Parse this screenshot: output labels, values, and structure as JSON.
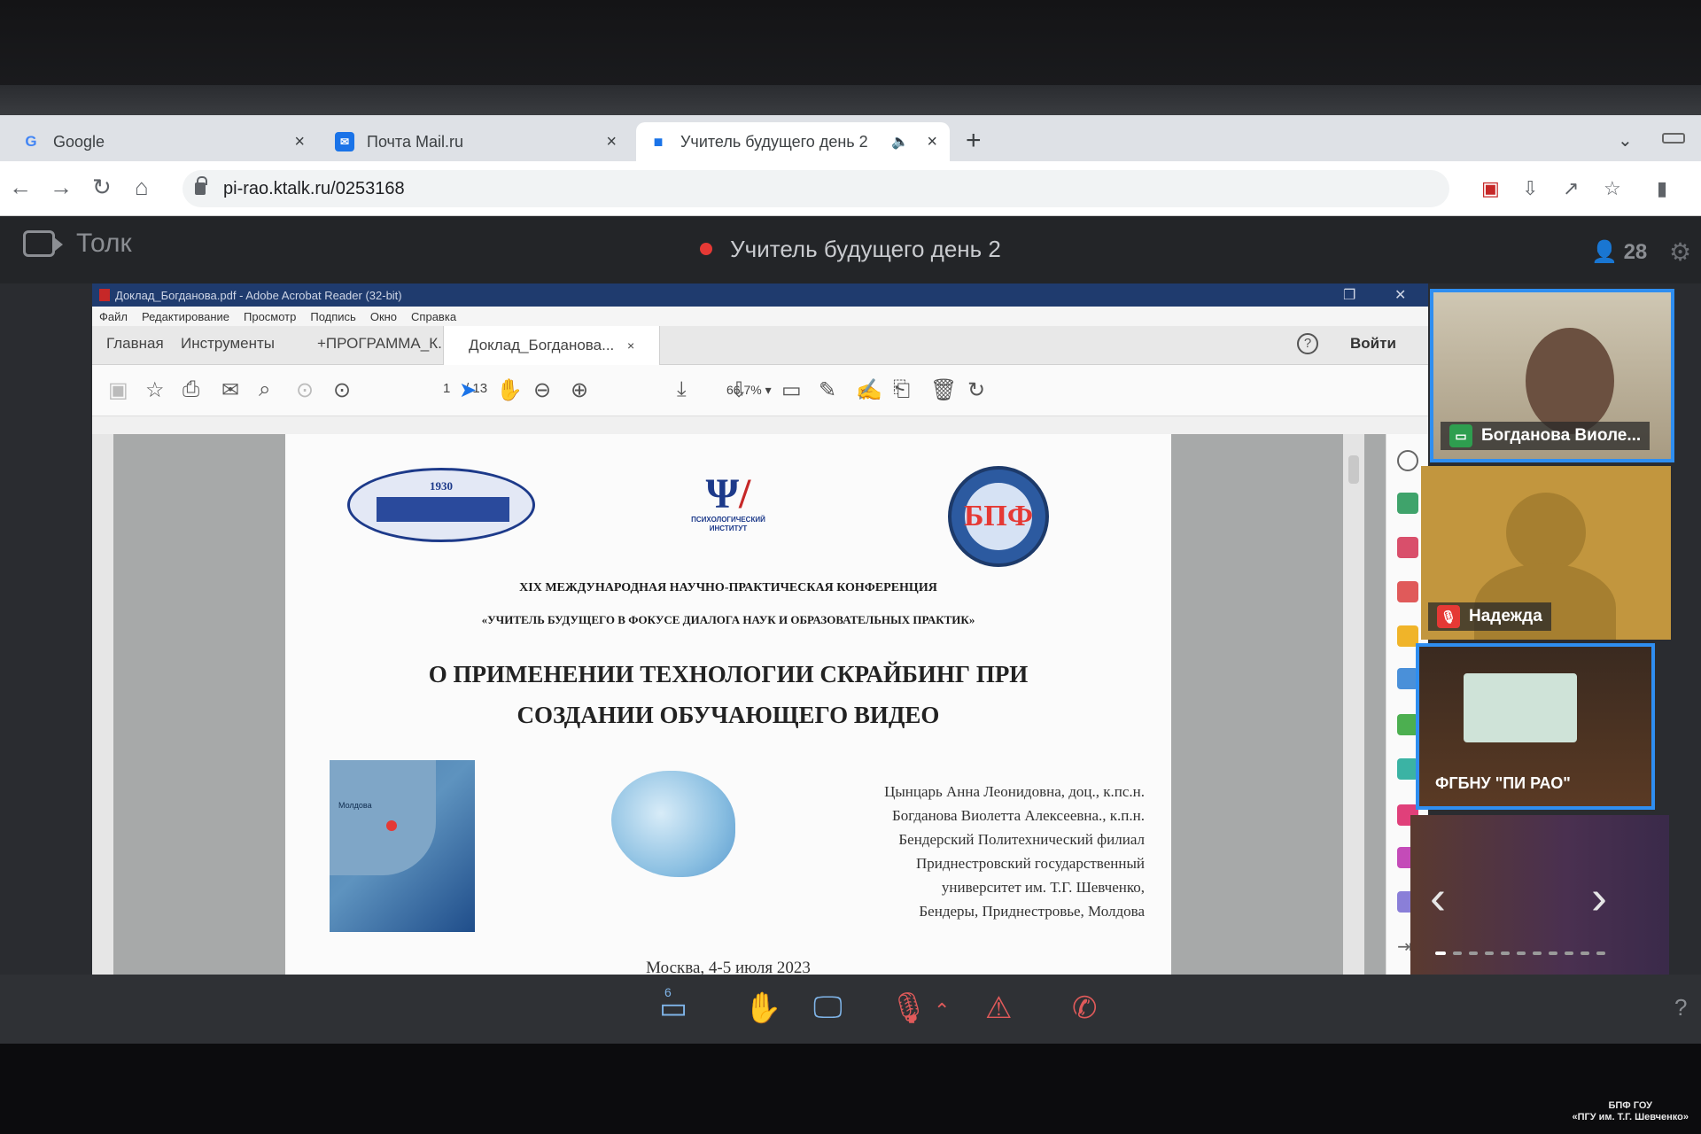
{
  "browser": {
    "tabs": [
      {
        "label": "Google"
      },
      {
        "label": "Почта Mail.ru"
      },
      {
        "label": "Учитель будущего день 2"
      }
    ],
    "url": "pi-rao.ktalk.ru/0253168"
  },
  "tolk": {
    "logo_label": "Толк",
    "meeting_title": "Учитель будущего день 2",
    "participant_count": "28"
  },
  "acrobat": {
    "window_title": "Доклад_Богданова.pdf - Adobe Acrobat Reader (32-bit)",
    "menu": [
      "Файл",
      "Редактирование",
      "Просмотр",
      "Подпись",
      "Окно",
      "Справка"
    ],
    "tabs": {
      "home": "Главная",
      "tools": "Инструменты",
      "doc1": "+ПРОГРАММА_К...",
      "doc2": "Доклад_Богданова..."
    },
    "signin": "Войти",
    "page_current": "1",
    "page_total": "/ 13",
    "zoom": "66,7%"
  },
  "document": {
    "logo_year": "1930",
    "logo2_text": "ПСИХОЛОГИЧЕСКИЙ ИНСТИТУТ",
    "logo3_text": "БПФ",
    "conference_line1": "XIX МЕЖДУНАРОДНАЯ НАУЧНО-ПРАКТИЧЕСКАЯ КОНФЕРЕНЦИЯ",
    "conference_line2": "«УЧИТЕЛЬ БУДУЩЕГО В ФОКУСЕ ДИАЛОГА НАУК И ОБРАЗОВАТЕЛЬНЫХ ПРАКТИК»",
    "title_line1": "О ПРИМЕНЕНИИ ТЕХНОЛОГИИ СКРАЙБИНГ ПРИ",
    "title_line2": "СОЗДАНИИ ОБУЧАЮЩЕГО ВИДЕО",
    "map_label": "Молдова",
    "authors": [
      "Цынцарь Анна Леонидовна, доц., к.пс.н.",
      "Богданова Виолетта Алексеевна., к.п.н.",
      "Бендерский Политехнический филиал",
      "Приднестровский государственный",
      "университет им. Т.Г. Шевченко,",
      "Бендеры, Приднестровье, Молдова"
    ],
    "city_date": "Москва, 4-5 июля 2023"
  },
  "participants": [
    {
      "name": "Богданова Виоле..."
    },
    {
      "name": "Надежда"
    },
    {
      "name": "ФГБНУ \"ПИ РАО\""
    }
  ],
  "controls": {
    "hand_count": "6",
    "help": "?"
  },
  "watermark": {
    "line1": "БПФ ГОУ",
    "line2": "«ПГУ им. Т.Г. Шевченко»"
  },
  "colors": {
    "accent": "#2f8ef0",
    "record": "#e53935",
    "mic_off": "#e53935",
    "screen_share": "#2e9e4f"
  }
}
